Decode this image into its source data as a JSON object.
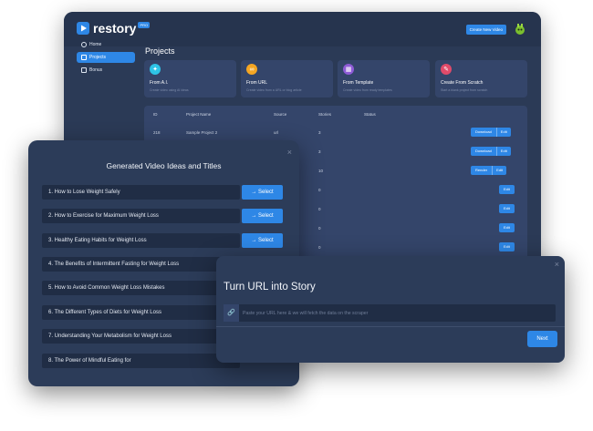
{
  "app": {
    "logo_text": "restory",
    "logo_badge": "PRO",
    "create_button": "Create New Video",
    "sidebar": [
      {
        "label": "Home",
        "icon": "home-icon"
      },
      {
        "label": "Projects",
        "icon": "folder-icon"
      },
      {
        "label": "Bonus",
        "icon": "gift-icon"
      }
    ],
    "page_title": "Projects",
    "cards": [
      {
        "title": "From A.I.",
        "desc": "Create video using AI ideas",
        "color": "#2ec4e6",
        "icon": "ai-icon"
      },
      {
        "title": "From URL",
        "desc": "Create video from a URL or blog article",
        "color": "#f5a623",
        "icon": "link-icon"
      },
      {
        "title": "From Template",
        "desc": "Create video from ready templates",
        "color": "#8e5bd6",
        "icon": "template-icon"
      },
      {
        "title": "Create From Scratch",
        "desc": "Start a blank project from scratch",
        "color": "#e04b6a",
        "icon": "scratch-icon"
      }
    ],
    "table": {
      "headers": [
        "ID",
        "Project Name",
        "Source",
        "Stories",
        "Status"
      ],
      "rows": [
        {
          "id": "218",
          "name": "Sample Project 2",
          "source": "url",
          "stories": "3",
          "action": "Download",
          "edit": "Edit"
        },
        {
          "id": "",
          "name": "",
          "source": "",
          "stories": "3",
          "action": "Download",
          "edit": "Edit"
        },
        {
          "id": "",
          "name": "",
          "source": "",
          "stories": "10",
          "action": "Render",
          "edit": "Edit"
        },
        {
          "id": "",
          "name": "",
          "source": "",
          "stories": "0",
          "action": "",
          "edit": "Edit"
        },
        {
          "id": "",
          "name": "",
          "source": "",
          "stories": "0",
          "action": "",
          "edit": "Edit"
        },
        {
          "id": "",
          "name": "",
          "source": "",
          "stories": "0",
          "action": "",
          "edit": "Edit"
        },
        {
          "id": "",
          "name": "",
          "source": "",
          "stories": "0",
          "action": "",
          "edit": "Edit"
        }
      ]
    }
  },
  "ideas_modal": {
    "title": "Generated Video Ideas and Titles",
    "close": "×",
    "select_label": "→ Select",
    "ideas": [
      "1. How to Lose Weight Safely",
      "2. How to Exercise for Maximum Weight Loss",
      "3. Healthy Eating Habits for Weight Loss",
      "4. The Benefits of Intermittent Fasting for Weight Loss",
      "5. How to Avoid Common Weight Loss Mistakes",
      "6. The Different Types of Diets for Weight Loss",
      "7. Understanding Your Metabolism for Weight Loss",
      "8. The Power of Mindful Eating for"
    ]
  },
  "url_modal": {
    "title": "Turn URL into Story",
    "close": "×",
    "placeholder": "Paste your URL here & we will fetch the data on the scraper",
    "link_icon": "🔗",
    "next_label": "Next"
  },
  "colors": {
    "accent": "#2e87e6",
    "panel": "#2b3a56",
    "card": "#34456a"
  }
}
